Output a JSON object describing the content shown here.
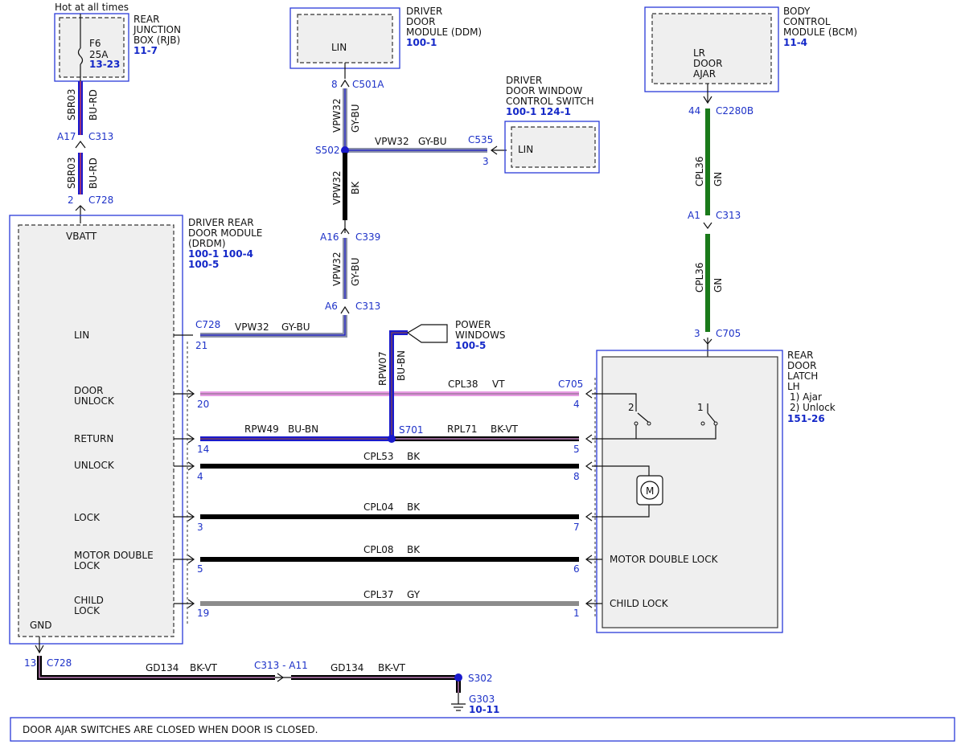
{
  "colors": {
    "wire_blue": "#1a1acc",
    "wire_gray_blue": "#8a8fa8",
    "wire_black": "#000000",
    "wire_green": "#1a7a1a",
    "wire_violet": "#e79be3",
    "wire_gray": "#8c8c8c",
    "ref_blue": "#1428c8",
    "box_blue": "#2a3ad8"
  },
  "title_hot": "Hot at all times",
  "modules": {
    "rjb": {
      "title": [
        "REAR",
        "JUNCTION",
        "BOX (RJB)"
      ],
      "ref": "11-7",
      "fuse": "F6",
      "amps": "25A",
      "fuse_ref": "13-23"
    },
    "ddm": {
      "title": [
        "DRIVER",
        "DOOR",
        "MODULE (DDM)"
      ],
      "ref": "100-1",
      "pin": "LIN"
    },
    "dwcs": {
      "title": [
        "DRIVER",
        "DOOR WINDOW",
        "CONTROL SWITCH"
      ],
      "ref": "100-1 124-1",
      "pin": "LIN"
    },
    "bcm": {
      "title": [
        "BODY",
        "CONTROL",
        "MODULE (BCM)"
      ],
      "ref": "11-4",
      "pin": [
        "LR",
        "DOOR",
        "AJAR"
      ]
    },
    "drdm": {
      "title": [
        "DRIVER REAR",
        "DOOR MODULE",
        "(DRDM)"
      ],
      "ref1": "100-1 100-4",
      "ref2": "100-5",
      "vbatt": "VBATT",
      "gnd": "GND",
      "pins": [
        {
          "label": [
            "LIN"
          ]
        },
        {
          "label": [
            "DOOR",
            "UNLOCK"
          ]
        },
        {
          "label": [
            "RETURN"
          ]
        },
        {
          "label": [
            "UNLOCK"
          ]
        },
        {
          "label": [
            "LOCK"
          ]
        },
        {
          "label": [
            "MOTOR DOUBLE",
            "LOCK"
          ]
        },
        {
          "label": [
            "CHILD",
            "LOCK"
          ]
        }
      ]
    },
    "latch": {
      "title": [
        "REAR",
        "DOOR",
        "LATCH",
        "LH"
      ],
      "notes": [
        "1) Ajar",
        "2) Unlock"
      ],
      "ref": "151-26",
      "motor": "M",
      "sw1": "1",
      "sw2": "2",
      "motor_double_lock": "MOTOR DOUBLE LOCK",
      "child_lock": "CHILD LOCK"
    },
    "power_windows": {
      "title": [
        "POWER",
        "WINDOWS"
      ],
      "ref": "100-5"
    }
  },
  "connectors": {
    "a17": "A17",
    "c313_top": "C313",
    "p2": "2",
    "c728_top": "C728",
    "p8": "8",
    "c501a": "C501A",
    "s502": "S502",
    "c535": "C535",
    "p3": "3",
    "a16": "A16",
    "c339": "C339",
    "a6": "A6",
    "c313_mid": "C313",
    "p44": "44",
    "c2280b": "C2280B",
    "a1": "A1",
    "c313_r": "C313",
    "p3b": "3",
    "c705_top": "C705",
    "c728_lin": "C728",
    "p21": "21",
    "p20": "20",
    "p14": "14",
    "p4": "4",
    "p3c": "3",
    "p5": "5",
    "p19": "19",
    "c705": "C705",
    "q4": "4",
    "q5": "5",
    "q8": "8",
    "q7": "7",
    "q6": "6",
    "q1": "1",
    "s701": "S701",
    "p13": "13",
    "c728_bot": "C728",
    "c313_bot": "C313 - A11",
    "s302": "S302",
    "g303": "G303",
    "g303_ref": "10-11"
  },
  "wires": {
    "sbr03_a": {
      "circuit": "SBR03",
      "color": "BU-RD"
    },
    "sbr03_b": {
      "circuit": "SBR03",
      "color": "BU-RD"
    },
    "vpw32_a": {
      "circuit": "VPW32",
      "color": "GY-BU"
    },
    "vpw32_h": {
      "circuit": "VPW32",
      "color": "GY-BU"
    },
    "vpw32_bk": {
      "circuit": "VPW32",
      "color": "BK"
    },
    "vpw32_c": {
      "circuit": "VPW32",
      "color": "GY-BU"
    },
    "vpw32_lin": {
      "circuit": "VPW32",
      "color": "GY-BU"
    },
    "cpl36_a": {
      "circuit": "CPL36",
      "color": "GN"
    },
    "cpl36_b": {
      "circuit": "CPL36",
      "color": "GN"
    },
    "rpw07": {
      "circuit": "RPW07",
      "color": "BU-BN"
    },
    "cpl38": {
      "circuit": "CPL38",
      "color": "VT"
    },
    "rpw49": {
      "circuit": "RPW49",
      "color": "BU-BN"
    },
    "rpl71": {
      "circuit": "RPL71",
      "color": "BK-VT"
    },
    "cpl53": {
      "circuit": "CPL53",
      "color": "BK"
    },
    "cpl04": {
      "circuit": "CPL04",
      "color": "BK"
    },
    "cpl08": {
      "circuit": "CPL08",
      "color": "BK"
    },
    "cpl37": {
      "circuit": "CPL37",
      "color": "GY"
    },
    "gd134_a": {
      "circuit": "GD134",
      "color": "BK-VT"
    },
    "gd134_b": {
      "circuit": "GD134",
      "color": "BK-VT"
    }
  },
  "note": "DOOR AJAR SWITCHES ARE CLOSED WHEN DOOR IS CLOSED."
}
